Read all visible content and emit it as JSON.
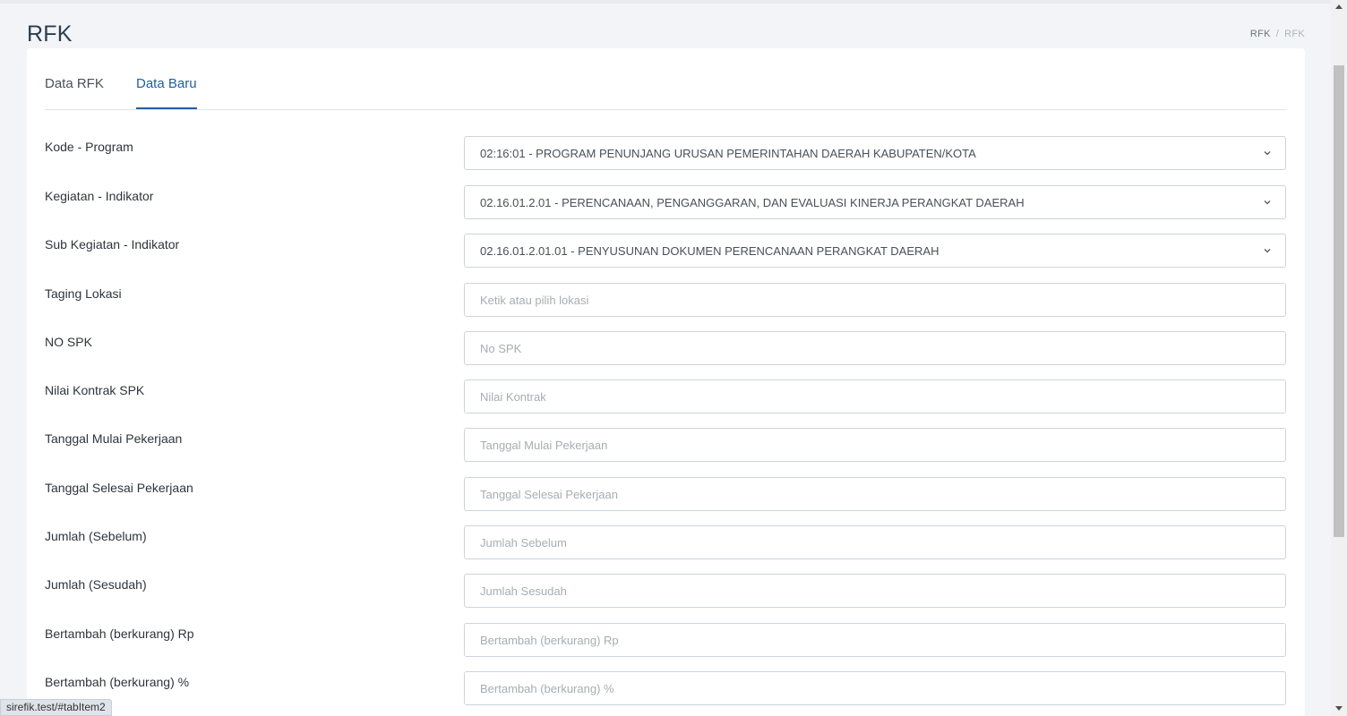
{
  "header": {
    "title": "RFK",
    "breadcrumb": [
      "RFK",
      "RFK"
    ]
  },
  "tabs": [
    {
      "label": "Data RFK",
      "active": false
    },
    {
      "label": "Data Baru",
      "active": true
    }
  ],
  "form": {
    "kode_program": {
      "label": "Kode - Program",
      "value": "02:16:01 - PROGRAM PENUNJANG URUSAN PEMERINTAHAN DAERAH KABUPATEN/KOTA",
      "icon": "chevron-down-icon"
    },
    "kegiatan": {
      "label": "Kegiatan - Indikator",
      "value": "02.16.01.2.01 - PERENCANAAN, PENGANGGARAN, DAN EVALUASI KINERJA PERANGKAT DAERAH",
      "icon": "chevron-down-icon"
    },
    "sub_kegiatan": {
      "label": "Sub Kegiatan - Indikator",
      "value": "02.16.01.2.01.01 - PENYUSUNAN DOKUMEN PERENCANAAN PERANGKAT DAERAH",
      "icon": "chevron-down-icon"
    },
    "taging_lokasi": {
      "label": "Taging Lokasi",
      "placeholder": "Ketik atau pilih lokasi",
      "value": ""
    },
    "no_spk": {
      "label": "NO SPK",
      "placeholder": "No SPK",
      "value": ""
    },
    "nilai_kontrak": {
      "label": "Nilai Kontrak SPK",
      "placeholder": "Nilai Kontrak",
      "value": ""
    },
    "tanggal_mulai": {
      "label": "Tanggal Mulai Pekerjaan",
      "placeholder": "Tanggal Mulai Pekerjaan",
      "value": ""
    },
    "tanggal_selesai": {
      "label": "Tanggal Selesai Pekerjaan",
      "placeholder": "Tanggal Selesai Pekerjaan",
      "value": ""
    },
    "jumlah_sebelum": {
      "label": "Jumlah (Sebelum)",
      "placeholder": "Jumlah Sebelum",
      "value": ""
    },
    "jumlah_sesudah": {
      "label": "Jumlah (Sesudah)",
      "placeholder": "Jumlah Sesudah",
      "value": ""
    },
    "bertambah_rp": {
      "label": "Bertambah (berkurang) Rp",
      "placeholder": "Bertambah (berkurang) Rp",
      "value": ""
    },
    "bertambah_pct": {
      "label": "Bertambah (berkurang) %",
      "placeholder": "Bertambah (berkurang) %",
      "value": ""
    }
  },
  "status_bar": {
    "url": "sirefik.test/#tabItem2"
  },
  "colors": {
    "accent": "#1f5f9e",
    "background": "#f3f4f7"
  }
}
